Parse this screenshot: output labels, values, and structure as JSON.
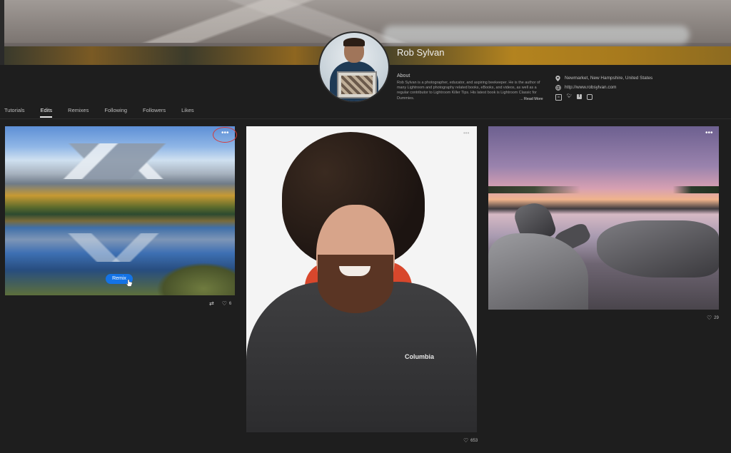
{
  "profile": {
    "name": "Rob Sylvan",
    "about_title": "About",
    "about_text": "Rob Sylvan is a photographer, educator, and aspiring beekeeper. He is the author of many Lightroom and photography related books, eBooks, and videos, as well as a regular contributor to Lightroom Killer Tips. His latest book is Lightroom Classic for Dummies.",
    "read_more": "... Read More",
    "location": "Newmarket, New Hampshire, United States",
    "website": "http://www.robsylvan.com",
    "social_icons": [
      "linkedin-icon",
      "twitter-icon",
      "facebook-icon",
      "instagram-icon"
    ]
  },
  "tabs": [
    {
      "label": "Tutorials",
      "active": false
    },
    {
      "label": "Edits",
      "active": true
    },
    {
      "label": "Remixes",
      "active": false
    },
    {
      "label": "Following",
      "active": false
    },
    {
      "label": "Followers",
      "active": false
    },
    {
      "label": "Likes",
      "active": false
    }
  ],
  "cards": [
    {
      "more": "•••",
      "remix_label": "Remix",
      "likes": "6"
    },
    {
      "more": "•••",
      "likes": "653"
    },
    {
      "more": "•••",
      "likes": "29"
    }
  ],
  "photo_text": {
    "jacket_brand": "Columbia"
  },
  "colors": {
    "accent": "#1473e6",
    "highlight_ring": "#d53a3a"
  }
}
